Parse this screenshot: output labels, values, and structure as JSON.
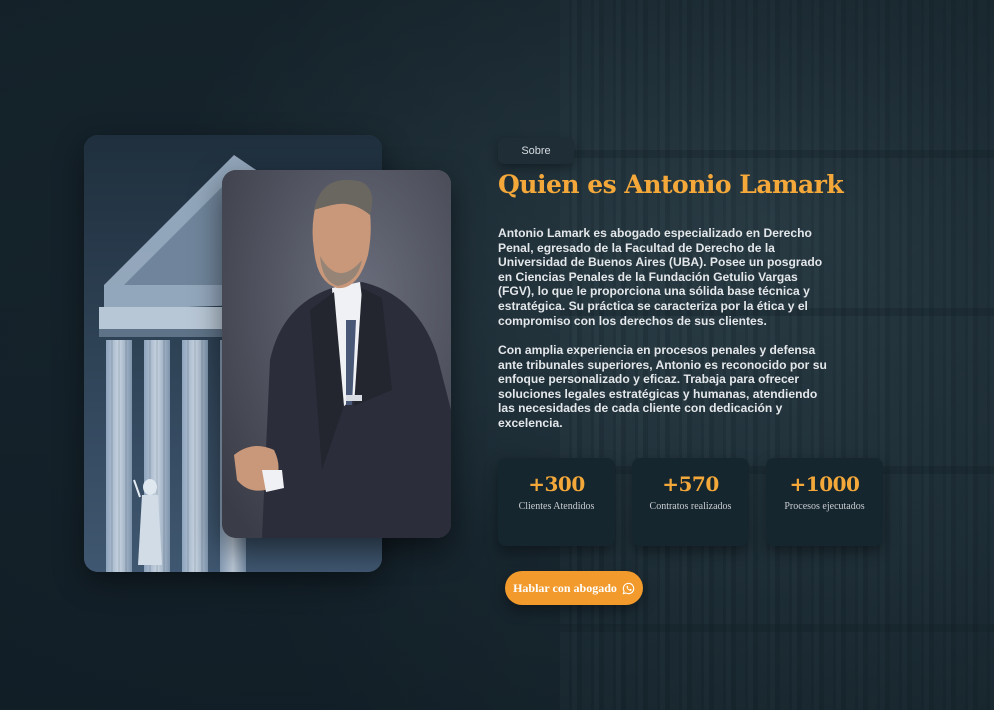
{
  "about": {
    "badge": "Sobre",
    "title": "Quien es Antonio Lamark",
    "paragraphs": [
      "Antonio Lamark es abogado especializado en Derecho Penal, egresado de la Facultad de Derecho de la Universidad de Buenos Aires (UBA). Posee un posgrado en Ciencias Penales de la Fundación Getulio Vargas (FGV), lo que le proporciona una sólida base técnica y estratégica. Su práctica se caracteriza por la ética y el compromiso con los derechos de sus clientes.",
      "Con amplia experiencia en procesos penales y defensa ante tribunales superiores, Antonio es reconocido por su enfoque personalizado y eficaz. Trabaja para ofrecer soluciones legales estratégicas y humanas, atendiendo las necesidades de cada cliente con dedicación y excelencia."
    ]
  },
  "stats": [
    {
      "value": "+300",
      "label": "Clientes Atendidos"
    },
    {
      "value": "+570",
      "label": "Contratos realizados"
    },
    {
      "value": "+1000",
      "label": "Procesos ejecutados"
    }
  ],
  "cta": {
    "label": "Hablar con abogado",
    "icon": "whatsapp-icon"
  },
  "colors": {
    "accent": "#f4a83a",
    "button": "#f29a2c",
    "background": "#14222b",
    "card": "#16262e"
  }
}
